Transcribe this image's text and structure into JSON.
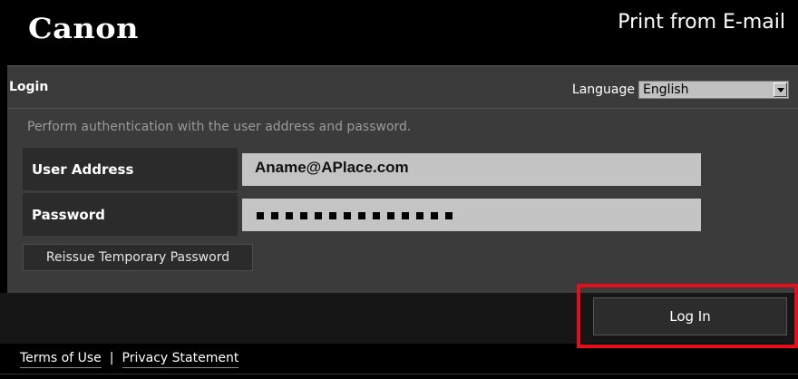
{
  "header": {
    "logo_text": "Canon",
    "app_title": "Print from E-mail"
  },
  "login": {
    "title": "Login",
    "language_label": "Language",
    "language_selected": "English",
    "description": "Perform authentication with the user address and password.",
    "user_address_label": "User Address",
    "user_address_value": "Aname@APlace.com",
    "password_label": "Password",
    "password_mask_length": 14,
    "reissue_button_label": "Reissue Temporary Password",
    "login_button_label": "Log In"
  },
  "footer": {
    "terms_label": "Terms of Use",
    "separator": "|",
    "privacy_label": "Privacy Statement"
  },
  "colors": {
    "background": "#000000",
    "panel": "#3b3b3b",
    "input_fill": "#c4c4c4",
    "highlight": "#e3101b"
  }
}
